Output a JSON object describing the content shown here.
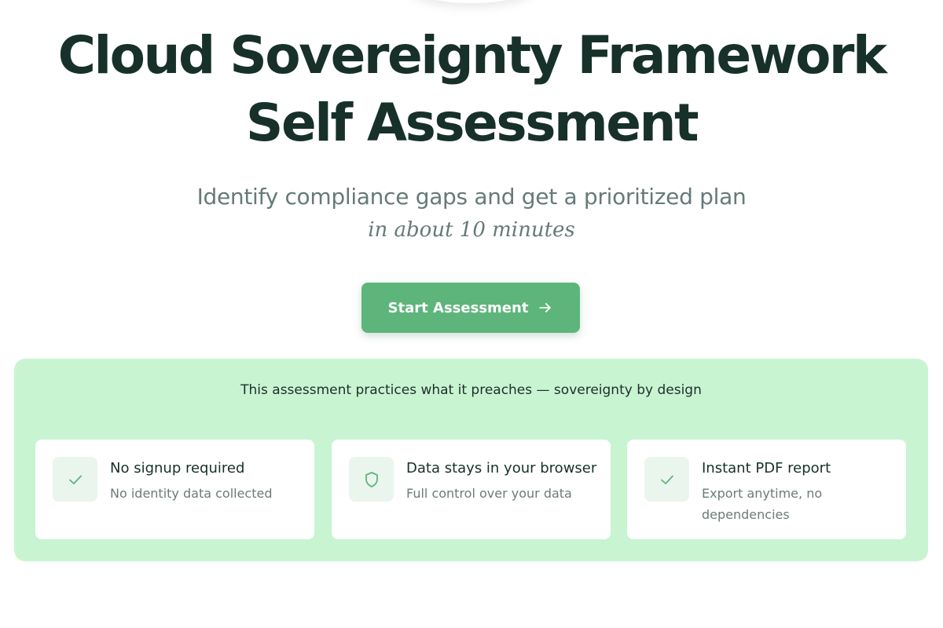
{
  "hero": {
    "title_line1": "Cloud Sovereignty Framework",
    "title_line2": "Self Assessment",
    "subtitle": "Identify compliance gaps and get a prioritized plan",
    "subtitle_emphasis": "in about 10 minutes"
  },
  "cta": {
    "label": "Start Assessment",
    "icon": "arrow-right-icon",
    "color": "#5db57b"
  },
  "trust_panel": {
    "heading": "This assessment practices what it preaches — sovereignty by design",
    "background": "#c8f4d2",
    "cards": [
      {
        "icon": "check-icon",
        "title": "No signup required",
        "description": "No identity data collected"
      },
      {
        "icon": "shield-icon",
        "title": "Data stays in your browser",
        "description": "Full control over your data"
      },
      {
        "icon": "check-icon",
        "title": "Instant PDF report",
        "description": "Export anytime, no dependencies"
      }
    ]
  }
}
